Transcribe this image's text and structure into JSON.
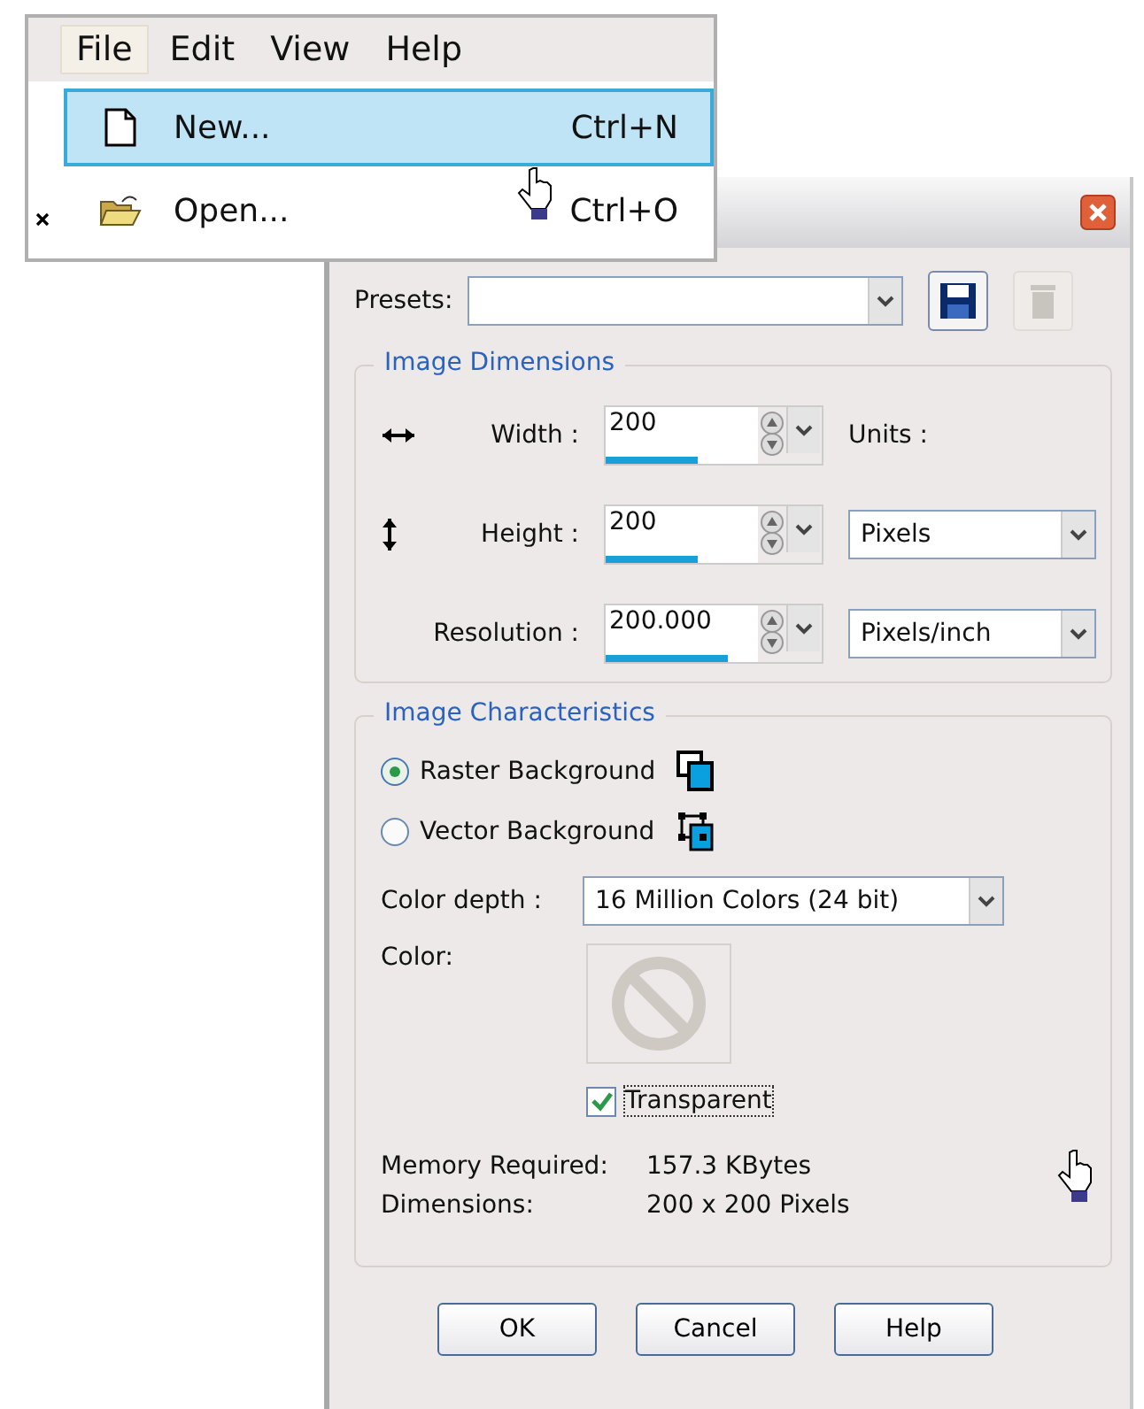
{
  "menu": {
    "menubar": [
      {
        "label": "File",
        "selected": true
      },
      {
        "label": "Edit",
        "selected": false
      },
      {
        "label": "View",
        "selected": false
      },
      {
        "label": "Help",
        "selected": false
      }
    ],
    "items": [
      {
        "kind": "new",
        "label": "New...",
        "shortcut": "Ctrl+N",
        "selected": true
      },
      {
        "kind": "open",
        "label": "Open...",
        "shortcut": "Ctrl+O",
        "selected": false
      }
    ]
  },
  "dialog": {
    "presets": {
      "label": "Presets:"
    },
    "preset_buttons": [
      {
        "kind": "save",
        "disabled": false
      },
      {
        "kind": "delete",
        "disabled": true
      }
    ],
    "image_dimensions": {
      "title": "Image Dimensions",
      "fields": [
        {
          "kind": "width",
          "label": "Width :",
          "value": "200",
          "level": 0.6
        },
        {
          "kind": "height",
          "label": "Height :",
          "value": "200",
          "level": 0.6
        },
        {
          "kind": "resolution",
          "label": "Resolution :",
          "value": "200.000",
          "level": 0.8
        }
      ],
      "units_label": "Units :",
      "units": "Pixels",
      "resolution_units": "Pixels/inch"
    },
    "image_characteristics": {
      "title": "Image Characteristics",
      "backgrounds": [
        {
          "kind": "raster",
          "label": "Raster Background",
          "selected": true
        },
        {
          "kind": "vector",
          "label": "Vector Background",
          "selected": false
        }
      ],
      "color_depth_label": "Color depth :",
      "color_depth": "16 Million Colors (24 bit)",
      "color_label": "Color:",
      "transparent": {
        "label": "Transparent",
        "checked": true
      },
      "info": [
        {
          "label": "Memory Required:",
          "value": "157.3 KBytes"
        },
        {
          "label": "Dimensions:",
          "value": "200 x 200 Pixels"
        }
      ]
    },
    "buttons": [
      {
        "label": "OK"
      },
      {
        "label": "Cancel"
      },
      {
        "label": "Help"
      }
    ]
  }
}
